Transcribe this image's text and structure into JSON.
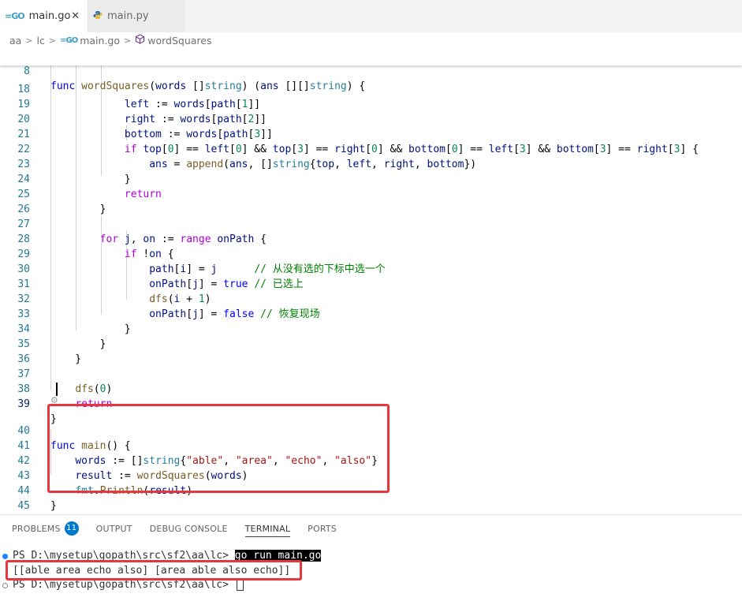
{
  "tabs": [
    {
      "icon": "go-file-icon",
      "label": "main.go",
      "active": true,
      "close": "✕"
    },
    {
      "icon": "python-file-icon",
      "label": "main.py",
      "active": false
    }
  ],
  "breadcrumb": {
    "parts": [
      "aa",
      "lc",
      "main.go",
      "wordSquares"
    ]
  },
  "editor": {
    "sticky": {
      "num": "8",
      "code": "func wordSquares(words []string) (ans [][]string) {"
    },
    "lines": [
      {
        "num": "18",
        "code": "            left := words[path[1]]"
      },
      {
        "num": "19",
        "code": "            right := words[path[2]]"
      },
      {
        "num": "20",
        "code": "            bottom := words[path[3]]"
      },
      {
        "num": "21",
        "code": "            if top[0] == left[0] && top[3] == right[0] && bottom[0] == left[3] && bottom[3] == right[3] {"
      },
      {
        "num": "22",
        "code": "                ans = append(ans, []string{top, left, right, bottom})"
      },
      {
        "num": "23",
        "code": "            }"
      },
      {
        "num": "24",
        "code": "            return"
      },
      {
        "num": "25",
        "code": "        }"
      },
      {
        "num": "26",
        "code": ""
      },
      {
        "num": "27",
        "code": "        for j, on := range onPath {"
      },
      {
        "num": "28",
        "code": "            if !on {"
      },
      {
        "num": "29",
        "code": "                path[i] = j      // 从没有选的下标中选一个"
      },
      {
        "num": "30",
        "code": "                onPath[j] = true // 已选上"
      },
      {
        "num": "31",
        "code": "                dfs(i + 1)"
      },
      {
        "num": "32",
        "code": "                onPath[j] = false // 恢复现场"
      },
      {
        "num": "33",
        "code": "            }"
      },
      {
        "num": "34",
        "code": "        }"
      },
      {
        "num": "35",
        "code": "    }"
      },
      {
        "num": "36",
        "code": ""
      },
      {
        "num": "37",
        "code": "    dfs(0)"
      },
      {
        "num": "38",
        "code": "    return"
      },
      {
        "num": "39",
        "code": "}"
      },
      {
        "num": "40",
        "code": "func main() {"
      },
      {
        "num": "41",
        "code": "    words := []string{\"able\", \"area\", \"echo\", \"also\"}"
      },
      {
        "num": "42",
        "code": "    result := wordSquares(words)"
      },
      {
        "num": "43",
        "code": "    fmt.Println(result)"
      },
      {
        "num": "44",
        "code": "}"
      },
      {
        "num": "45",
        "code": ""
      }
    ]
  },
  "panel": {
    "tabs": [
      {
        "label": "PROBLEMS",
        "badge": "11",
        "active": false
      },
      {
        "label": "OUTPUT",
        "active": false
      },
      {
        "label": "DEBUG CONSOLE",
        "active": false
      },
      {
        "label": "TERMINAL",
        "active": true
      },
      {
        "label": "PORTS",
        "active": false
      }
    ]
  },
  "terminal": {
    "line1_prompt": "PS D:\\mysetup\\gopath\\src\\sf2\\aa\\lc> ",
    "line1_cmd": "go run main.go",
    "line2": "[[able area echo also] [area able also echo]]",
    "line3_prompt": "PS D:\\mysetup\\gopath\\src\\sf2\\aa\\lc> "
  },
  "colors": {
    "accent": "#007acc",
    "highlight_box": "#e8373c"
  }
}
